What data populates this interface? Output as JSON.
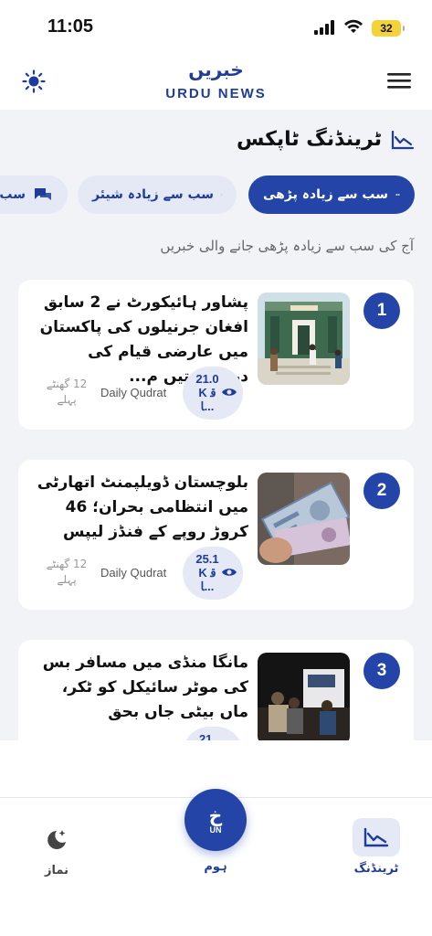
{
  "status_bar": {
    "time": "11:05",
    "battery": "32"
  },
  "header": {
    "logo_urdu": "خبریں",
    "logo_english": "URDU NEWS"
  },
  "section": {
    "title": "ٹرینڈنگ ٹاپکس",
    "chips": [
      "سب سے زیادہ پڑھی",
      "سب سے زیادہ شیئر",
      "سب"
    ],
    "subtitle": "آج کی سب سے زیادہ پڑھی جانے والی خبریں"
  },
  "articles": [
    {
      "rank": "1",
      "headline": "پشاور ہائیکورٹ نے 2 سابق افغان جرنیلوں کی پاکستان میں عارضی قیام کی درخواستیں م...",
      "views": "21.0K قا...",
      "source": "Daily Qudrat",
      "time_ago": "12 گھنٹے پہلے"
    },
    {
      "rank": "2",
      "headline": "بلوچستان ڈویلپمنٹ اتھارٹی میں انتظامی بحران؛ 46 کروڑ روپے کے فنڈز لیپس",
      "views": "25.1K قا...",
      "source": "Daily Qudrat",
      "time_ago": "12 گھنٹے پہلے"
    },
    {
      "rank": "3",
      "headline": "مانگا منڈی میں مسافر بس کی موٹر سائیکل کو ٹکر، ماں بیٹی جاں بحق",
      "views": "21.",
      "source": "",
      "time_ago": ""
    }
  ],
  "bottom_nav": {
    "trending": "ٹرینڈنگ",
    "home": "ہوم",
    "home_fab_urdu": "خ",
    "home_fab_en": "UN",
    "namaz": "نماز"
  },
  "colors": {
    "accent": "#2444a8",
    "chip_bg": "#e4e9f5",
    "page_bg": "#f2f3f7"
  }
}
